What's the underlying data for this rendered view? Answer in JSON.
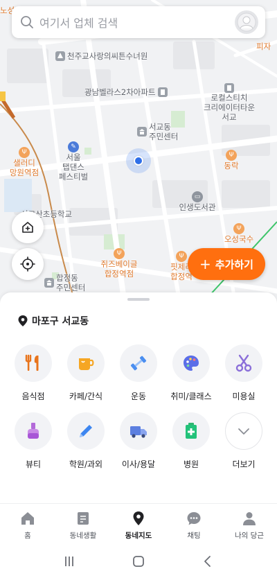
{
  "search": {
    "placeholder": "여기서 업체 검색"
  },
  "map": {
    "labels": {
      "church": "천주교사랑의씨튼수녀원",
      "apartment": "광남벨라스2차아파트",
      "creator_town": "로컬스티치\n크리에이터타운\n서교",
      "seogyo_center": "서교동\n주민센터",
      "seoul_tapdance": "서울\n탭댄스\n페스티벌",
      "salad": "샐러디\n망원역점",
      "donglak": "동락",
      "library": "인생도서관",
      "school": "서교산초등학교",
      "osung": "오성국수",
      "cheese": "쥐즈베이글\n합정역점",
      "hapjeong_center": "합정동\n주민센터",
      "pizza": "핏제리\n합정역",
      "edge_top": "노성단",
      "edge_right": "피자"
    }
  },
  "add_button": {
    "label": "추가하기"
  },
  "sheet": {
    "location": "마포구 서교동",
    "categories": [
      {
        "label": "음식점",
        "icon": "fork-knife-icon"
      },
      {
        "label": "카페/간식",
        "icon": "coffee-cup-icon"
      },
      {
        "label": "운동",
        "icon": "dumbbell-icon"
      },
      {
        "label": "취미/클래스",
        "icon": "palette-icon"
      },
      {
        "label": "미용실",
        "icon": "scissors-icon"
      },
      {
        "label": "뷰티",
        "icon": "nail-polish-icon"
      },
      {
        "label": "학원/과외",
        "icon": "pencil-icon"
      },
      {
        "label": "이사/용달",
        "icon": "truck-icon"
      },
      {
        "label": "병원",
        "icon": "medical-kit-icon"
      },
      {
        "label": "더보기",
        "icon": "chevron-down-icon"
      }
    ]
  },
  "bottom_nav": [
    {
      "label": "홈",
      "icon": "home-icon"
    },
    {
      "label": "동네생활",
      "icon": "document-icon"
    },
    {
      "label": "동네지도",
      "icon": "map-pin-icon",
      "active": true
    },
    {
      "label": "채팅",
      "icon": "chat-icon"
    },
    {
      "label": "나의 당근",
      "icon": "person-icon"
    }
  ],
  "colors": {
    "accent": "#ff6f0f",
    "location_blue": "#2f6fe8",
    "poi_orange": "#e07a2e"
  }
}
